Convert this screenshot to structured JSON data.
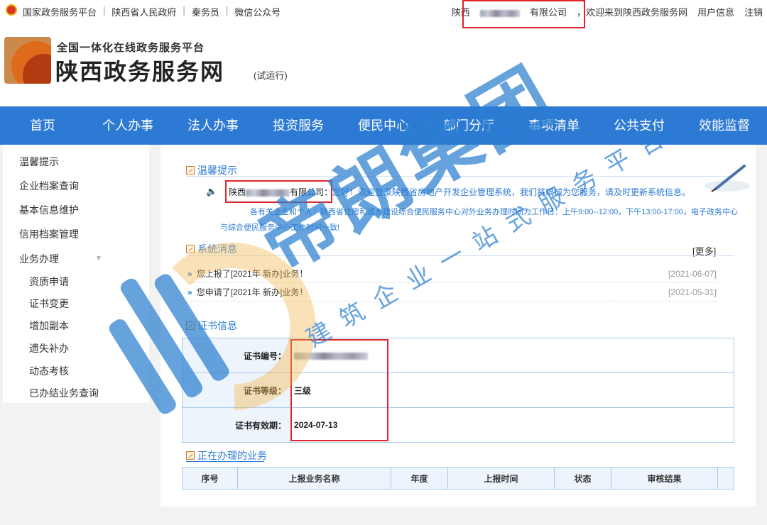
{
  "topbar": {
    "links": [
      "国家政务服务平台",
      "陕西省人民政府",
      "秦务员",
      "微信公众号"
    ],
    "company_prefix": "陕西",
    "company_suffix": "有限公司",
    "welcome": "，欢迎来到陕西政务服务网",
    "user_info": "用户信息",
    "logout": "注销"
  },
  "header": {
    "subtitle": "全国一体化在线政务服务平台",
    "title": "陕西政务服务网",
    "trial": "(试运行)"
  },
  "nav": [
    "首页",
    "个人办事",
    "法人办事",
    "投资服务",
    "便民中心",
    "部门分厅",
    "事项清单",
    "公共支付",
    "效能监督"
  ],
  "sidebar": {
    "items": [
      "温馨提示",
      "企业档案查询",
      "基本信息维护",
      "信用档案管理",
      "业务办理"
    ],
    "arrow": "▼",
    "subitems": [
      "资质申请",
      "证书变更",
      "增加副本",
      "遗失补办",
      "动态考核",
      "已办结业务查询"
    ]
  },
  "notice": {
    "title": "温馨提示",
    "company_prefix": "陕西",
    "company_suffix": "有限公司：",
    "greeting": "您好！欢迎登录陕西省房地产开发企业管理系统，我们将竭诚为您服务，请及时更新系统信息。",
    "paragraph": "各有关企业和个人：陕西省住房和城乡建设综合便民服务中心对外业务办理时间为工作日：上午9:00--12:00，下午13:00-17:00，电子政务中心与综合便民服务中心工作时间一致!"
  },
  "messages": {
    "title": "系统消息",
    "more": "[更多]",
    "items": [
      {
        "text": "您上报了[2021年 新办]业务！",
        "date": "[2021-06-07]"
      },
      {
        "text": "您申请了[2021年 新办]业务！",
        "date": "[2021-05-31]"
      }
    ]
  },
  "certificate": {
    "title": "证书信息",
    "rows": [
      {
        "label": "证书编号：",
        "value": ""
      },
      {
        "label": "证书等级：",
        "value": "三级"
      },
      {
        "label": "证书有效期：",
        "value": "2024-07-13"
      }
    ]
  },
  "business": {
    "title": "正在办理的业务",
    "columns": [
      "序号",
      "上报业务名称",
      "年度",
      "上报时间",
      "状态",
      "审核结果"
    ]
  },
  "watermark": {
    "brand": "帝朗集团",
    "slogan": "建筑企业一站式服务平台"
  },
  "colors": {
    "nav_blue": "#2d7ad4",
    "highlight_red": "#e0242d",
    "watermark_blue": "#2b7fd0"
  }
}
